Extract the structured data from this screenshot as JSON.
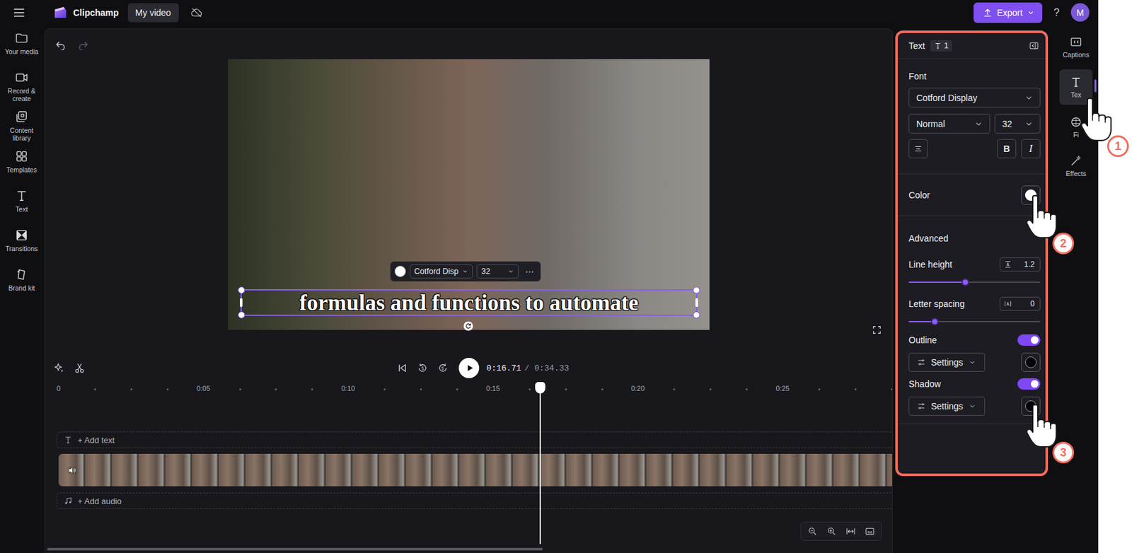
{
  "app": {
    "name": "Clipchamp",
    "project": "My video",
    "export": "Export",
    "help": "?",
    "avatar": "M"
  },
  "nav": [
    {
      "label": "Your media"
    },
    {
      "label": "Record & create"
    },
    {
      "label": "Content library"
    },
    {
      "label": "Templates"
    },
    {
      "label": "Text"
    },
    {
      "label": "Transitions"
    },
    {
      "label": "Brand kit"
    }
  ],
  "preview": {
    "caption": "formulas and functions to automate",
    "toolbar": {
      "font": "Cotford Disp",
      "size": "32",
      "more": "⋯"
    }
  },
  "playback": {
    "time": "0:16.71",
    "duration": "/ 0:34.33",
    "playhead_level": 0.578
  },
  "ruler": [
    "0",
    "0:05",
    "0:10",
    "0:15",
    "0:20",
    "0:25"
  ],
  "tracks": {
    "text": "+ Add text",
    "audio": "+ Add audio"
  },
  "panel": {
    "title": "Text",
    "badge": "1",
    "font_label": "Font",
    "font": "Cotford Display",
    "weight": "Normal",
    "size": "32",
    "bold": "B",
    "italic": "I",
    "color_label": "Color",
    "swatch": "#ffffff",
    "advanced": "Advanced",
    "sliders": [
      {
        "label": "Line height",
        "value": "1.2",
        "level": 0.43
      },
      {
        "label": "Letter spacing",
        "value": "0",
        "level": 0.2
      }
    ],
    "toggles": [
      {
        "label": "Outline",
        "on": true,
        "settings": "Settings",
        "color": "#000000"
      },
      {
        "label": "Shadow",
        "on": true,
        "settings": "Settings",
        "color": "#000000"
      }
    ]
  },
  "side_tabs": [
    {
      "label": "Captions",
      "selected": false
    },
    {
      "label": "Tex",
      "selected": true
    },
    {
      "label": "Fi",
      "selected": false
    },
    {
      "label": "Effects",
      "selected": false
    }
  ],
  "annotations": [
    {
      "label": "1"
    },
    {
      "label": "2"
    },
    {
      "label": "3"
    }
  ]
}
